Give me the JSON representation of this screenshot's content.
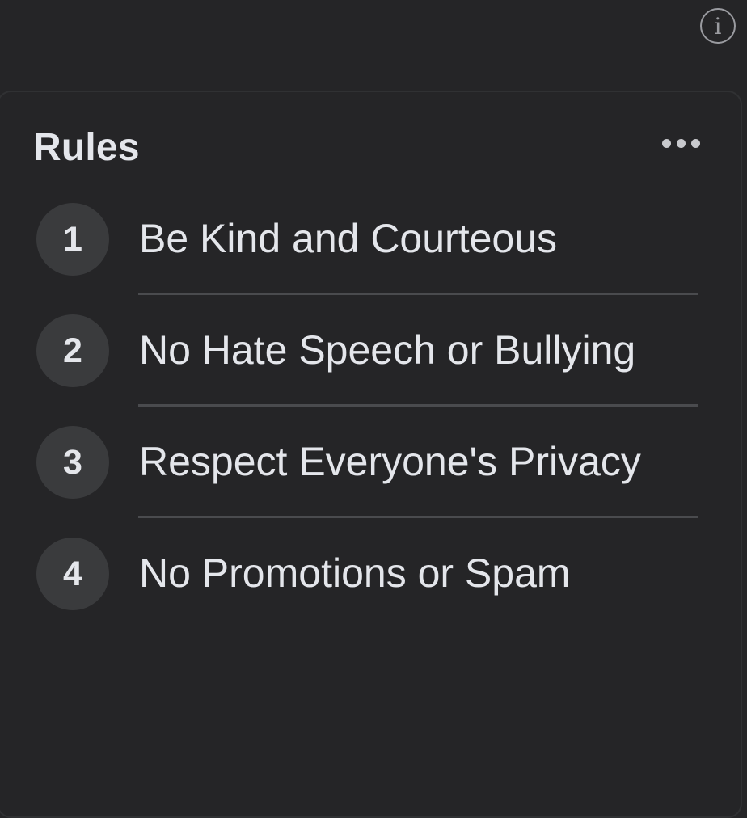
{
  "info_button": {
    "icon": "info-icon",
    "glyph": "i"
  },
  "card": {
    "title": "Rules",
    "more_icon": "more-horizontal-icon"
  },
  "rules": [
    {
      "number": "1",
      "text": "Be Kind and Courteous"
    },
    {
      "number": "2",
      "text": "No Hate Speech or Bullying"
    },
    {
      "number": "3",
      "text": "Respect Everyone's Privacy"
    },
    {
      "number": "4",
      "text": "No Promotions or Spam"
    }
  ],
  "colors": {
    "background": "#252527",
    "badge": "#3a3b3d",
    "text": "#e4e6eb",
    "divider": "#4a4b4e",
    "icon_muted": "#9a9ba0"
  }
}
